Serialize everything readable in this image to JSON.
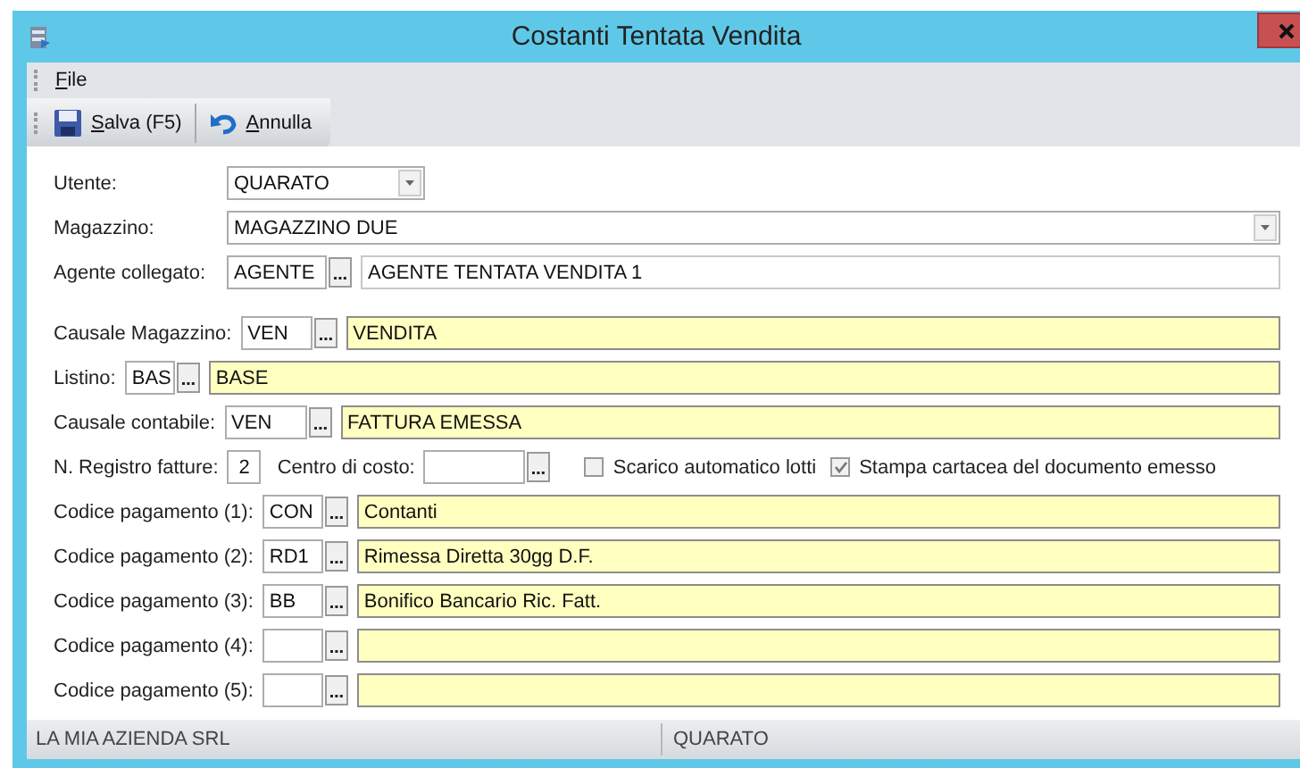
{
  "window": {
    "title": "Costanti Tentata Vendita"
  },
  "menu": [
    {
      "label": "File"
    }
  ],
  "toolbar": [
    {
      "label": "Salva (F5)",
      "kind": "save"
    },
    {
      "label": "Annulla",
      "kind": "undo"
    }
  ],
  "form": {
    "utente": {
      "label": "Utente:",
      "value": "QUARATO"
    },
    "magazzino": {
      "label": "Magazzino:",
      "value": "MAGAZZINO DUE"
    },
    "agente": {
      "label": "Agente collegato:",
      "code": "AGENTE",
      "description": "AGENTE TENTATA VENDITA 1"
    },
    "lookups": [
      {
        "label": "Causale Magazzino:",
        "code": "VEN",
        "description": "VENDITA"
      },
      {
        "label": "Listino:",
        "code": "BAS",
        "description": "BASE"
      },
      {
        "label": "Causale contabile:",
        "code": "VEN",
        "description": "FATTURA EMESSA"
      }
    ],
    "registro": {
      "label": "N. Registro fatture:",
      "value": "2"
    },
    "centro": {
      "label": "Centro di costo:"
    },
    "options": [
      {
        "label": "Scarico automatico lotti",
        "checked": false
      },
      {
        "label": "Stampa cartacea del documento emesso",
        "checked": true
      }
    ],
    "payments": [
      {
        "label": "Codice pagamento (1):",
        "code": "CON",
        "description": "Contanti"
      },
      {
        "label": "Codice pagamento (2):",
        "code": "RD1",
        "description": "Rimessa Diretta 30gg D.F."
      },
      {
        "label": "Codice pagamento (3):",
        "code": "BB",
        "description": "Bonifico Bancario Ric. Fatt."
      },
      {
        "label": "Codice pagamento (4):"
      },
      {
        "label": "Codice pagamento (5):"
      }
    ]
  },
  "status_bar": [
    "LA MIA AZIENDA SRL",
    "QUARATO"
  ]
}
